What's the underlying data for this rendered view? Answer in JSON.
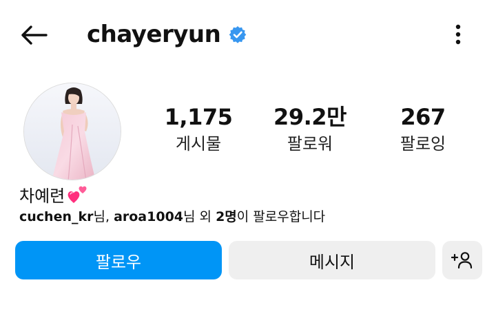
{
  "header": {
    "back_icon": "arrow-left-icon",
    "username": "chayeryun",
    "verified_icon": "verified-badge-icon",
    "verified_color": "#3897f0",
    "more_icon": "more-vertical-icon"
  },
  "profile": {
    "avatar_icon": "profile-photo",
    "full_name": "차예련",
    "name_emoji_icon": "two-hearts-icon"
  },
  "stats": {
    "posts": {
      "value": "1,175",
      "label": "게시물"
    },
    "followers": {
      "value": "29.2만",
      "label": "팔로워"
    },
    "following": {
      "value": "267",
      "label": "팔로잉"
    }
  },
  "followed_by": {
    "user1": "cuchen_kr",
    "suffix1": "님, ",
    "user2": "aroa1004",
    "suffix2": "님 외 ",
    "count": "2명",
    "suffix3": "이 팔로우합니다"
  },
  "actions": {
    "follow_label": "팔로우",
    "message_label": "메시지",
    "add_user_icon": "add-person-icon",
    "follow_color": "#0095f6",
    "secondary_color": "#efefef"
  }
}
